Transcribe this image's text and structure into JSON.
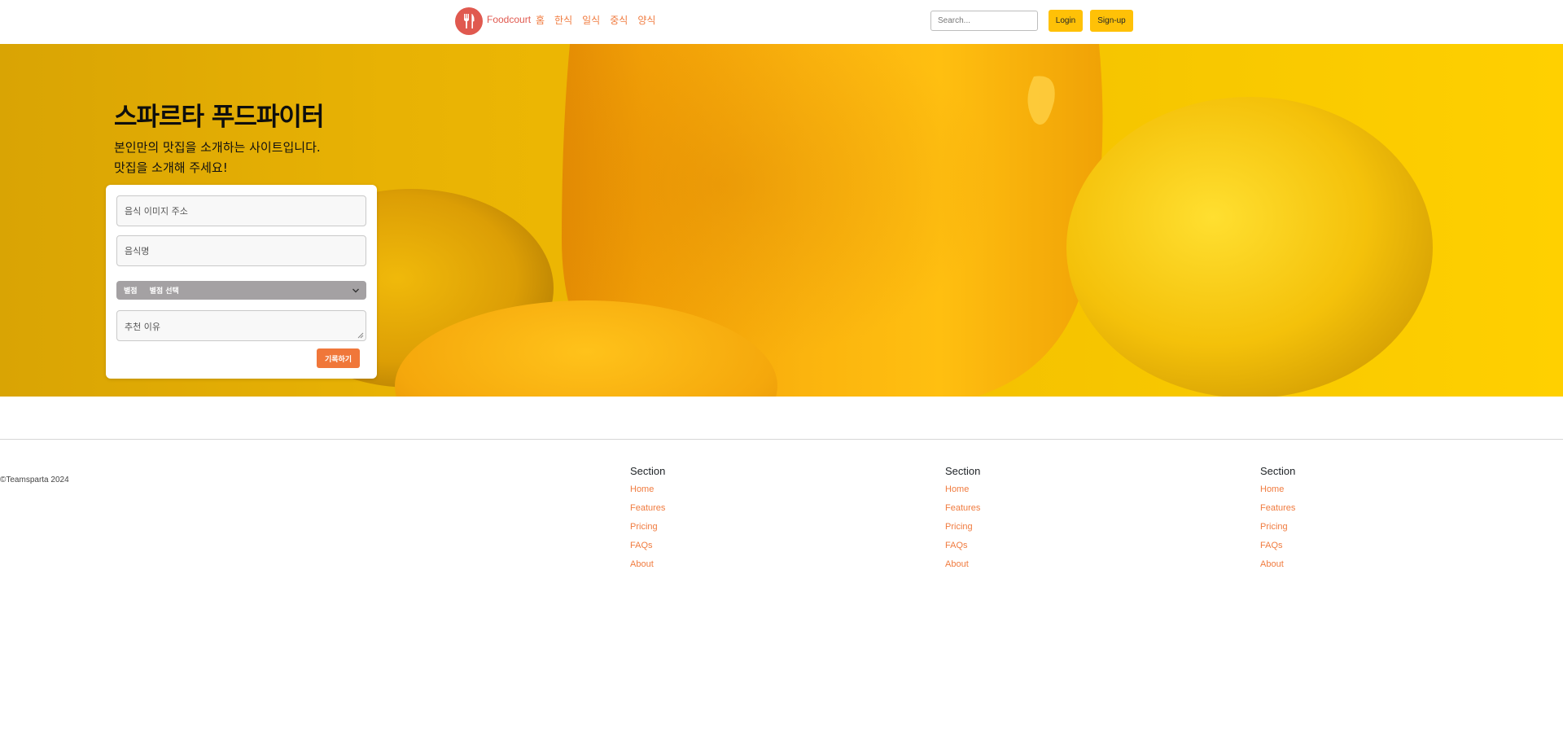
{
  "nav": {
    "brand": "Foodcourt",
    "logo_icon": "fork-knife-icon",
    "links": [
      "홈",
      "한식",
      "일식",
      "중식",
      "양식"
    ],
    "search_placeholder": "Search...",
    "login_label": "Login",
    "signup_label": "Sign-up",
    "brand_color": "#e0594f",
    "accent_color": "#ffc107"
  },
  "hero": {
    "title": "스파르타 푸드파이터",
    "subtitle_line1": "본인만의 맛집을 소개하는 사이트입니다.",
    "subtitle_line2": "맛집을 소개해 주세요!"
  },
  "form": {
    "image_placeholder": "음식 이미지 주소",
    "name_placeholder": "음식명",
    "rating_label": "별점",
    "rating_value": "별점 선택",
    "reason_placeholder": "추천 이유",
    "submit_label": "기록하기",
    "submit_color": "#f0773a"
  },
  "footer": {
    "copyright": "©Teamsparta 2024",
    "sections": [
      {
        "title": "Section",
        "links": [
          "Home",
          "Features",
          "Pricing",
          "FAQs",
          "About"
        ]
      },
      {
        "title": "Section",
        "links": [
          "Home",
          "Features",
          "Pricing",
          "FAQs",
          "About"
        ]
      },
      {
        "title": "Section",
        "links": [
          "Home",
          "Features",
          "Pricing",
          "FAQs",
          "About"
        ]
      }
    ]
  }
}
